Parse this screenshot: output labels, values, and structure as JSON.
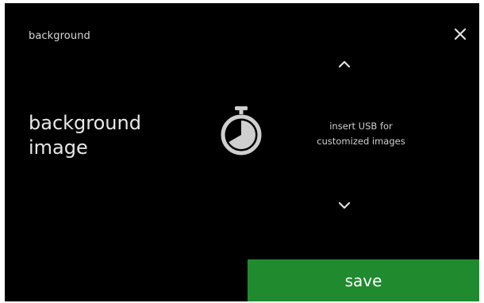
{
  "header": {
    "title": "background"
  },
  "setting": {
    "label_line1": "background",
    "label_line2": "image"
  },
  "option": {
    "icon": "timer-icon",
    "text_line1": "insert USB for",
    "text_line2": "customized images"
  },
  "actions": {
    "close_icon": "close-icon",
    "up_icon": "chevron-up-icon",
    "down_icon": "chevron-down-icon",
    "save_label": "save"
  },
  "colors": {
    "screen_background": "#000000",
    "save_button": "#1f8a2e",
    "icon": "#cfcfcf"
  }
}
